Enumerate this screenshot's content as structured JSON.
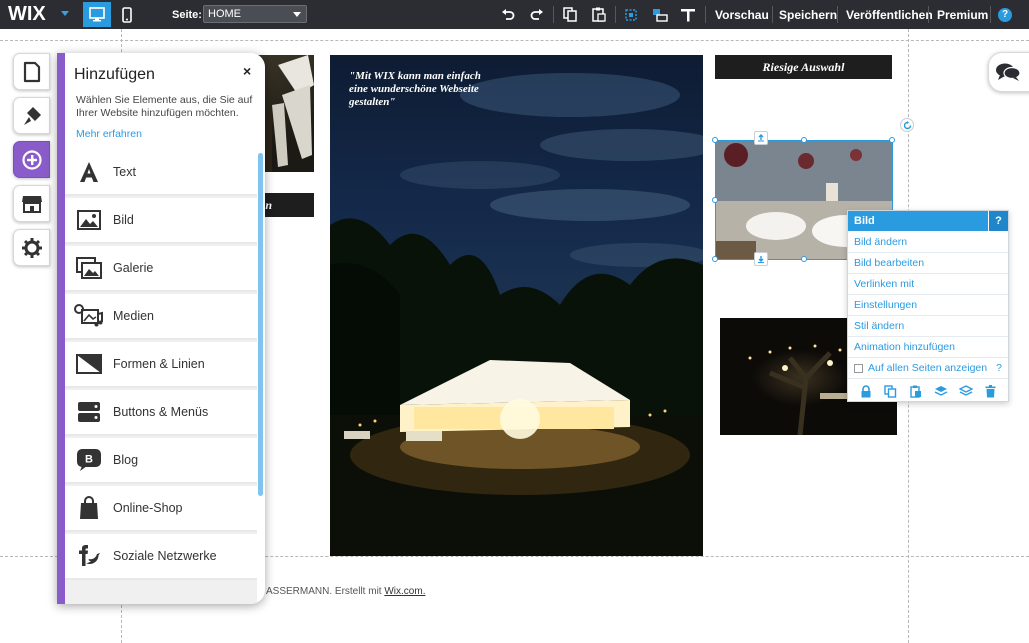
{
  "topbar": {
    "logo": "WIX",
    "page_label": "Seite:",
    "page_value": "HOME",
    "preview": "Vorschau",
    "save": "Speichern",
    "publish": "Veröffentlichen",
    "premium": "Premium",
    "help": "?"
  },
  "canvas": {
    "quote": "\"Mit WIX kann man einfach eine wunderschöne Webseite gestalten\"",
    "banner_right": "Riesige Auswahl",
    "banner_left": "en",
    "footer_prefix": "ASSERMANN. Erstellt mit ",
    "footer_link": "Wix.com."
  },
  "add_panel": {
    "title": "Hinzufügen",
    "close": "×",
    "description": "Wählen Sie Elemente aus, die Sie auf Ihrer Website hinzufügen möchten.",
    "more_link": "Mehr erfahren",
    "items": [
      {
        "label": "Text",
        "icon": "text-icon"
      },
      {
        "label": "Bild",
        "icon": "image-icon"
      },
      {
        "label": "Galerie",
        "icon": "gallery-icon"
      },
      {
        "label": "Medien",
        "icon": "media-icon"
      },
      {
        "label": "Formen & Linien",
        "icon": "shapes-icon"
      },
      {
        "label": "Buttons & Menüs",
        "icon": "buttons-menus-icon"
      },
      {
        "label": "Blog",
        "icon": "blog-icon"
      },
      {
        "label": "Online-Shop",
        "icon": "shopping-bag-icon"
      },
      {
        "label": "Soziale Netzwerke",
        "icon": "social-icon"
      }
    ]
  },
  "context_menu": {
    "title": "Bild",
    "help": "?",
    "items": [
      "Bild ändern",
      "Bild bearbeiten",
      "Verlinken mit",
      "Einstellungen",
      "Stil ändern",
      "Animation hinzufügen"
    ],
    "show_all_pages": "Auf allen Seiten anzeigen",
    "show_all_help": "?"
  },
  "colors": {
    "topbar": "#2b2d32",
    "accent_blue": "#2b9be0",
    "accent_purple": "#8a5cc9"
  }
}
